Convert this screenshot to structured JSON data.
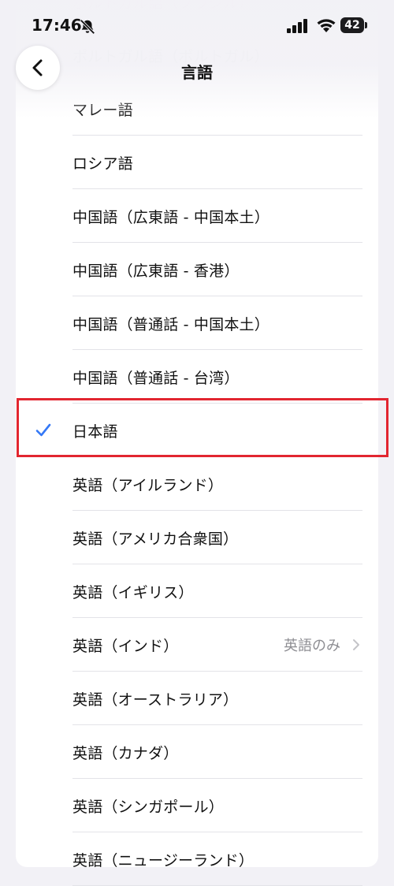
{
  "status_bar": {
    "time": "17:46",
    "battery": "42",
    "icons": [
      "bell-slash-icon",
      "signal-icon",
      "wifi-icon",
      "battery-icon"
    ]
  },
  "nav": {
    "title": "言語",
    "back_icon": "chevron-left-icon"
  },
  "faded_items": [
    "ポルトガル語（ブラジル）",
    "ポルトガル語（ポルトガル）"
  ],
  "languages": [
    {
      "label": "マレー語"
    },
    {
      "label": "ロシア語"
    },
    {
      "label": "中国語（広東語 - 中国本土）"
    },
    {
      "label": "中国語（広東語 - 香港）"
    },
    {
      "label": "中国語（普通話 - 中国本土）"
    },
    {
      "label": "中国語（普通話 - 台湾）"
    },
    {
      "label": "日本語",
      "selected": true
    },
    {
      "label": "英語（アイルランド）"
    },
    {
      "label": "英語（アメリカ合衆国）"
    },
    {
      "label": "英語（イギリス）"
    },
    {
      "label": "英語（インド）",
      "detail": "英語のみ"
    },
    {
      "label": "英語（オーストラリア）"
    },
    {
      "label": "英語（カナダ）"
    },
    {
      "label": "英語（シンガポール）"
    },
    {
      "label": "英語（ニュージーランド）"
    }
  ],
  "colors": {
    "accent": "#3478f6",
    "highlight_border": "#e22630",
    "background": "#f2f1f6"
  }
}
